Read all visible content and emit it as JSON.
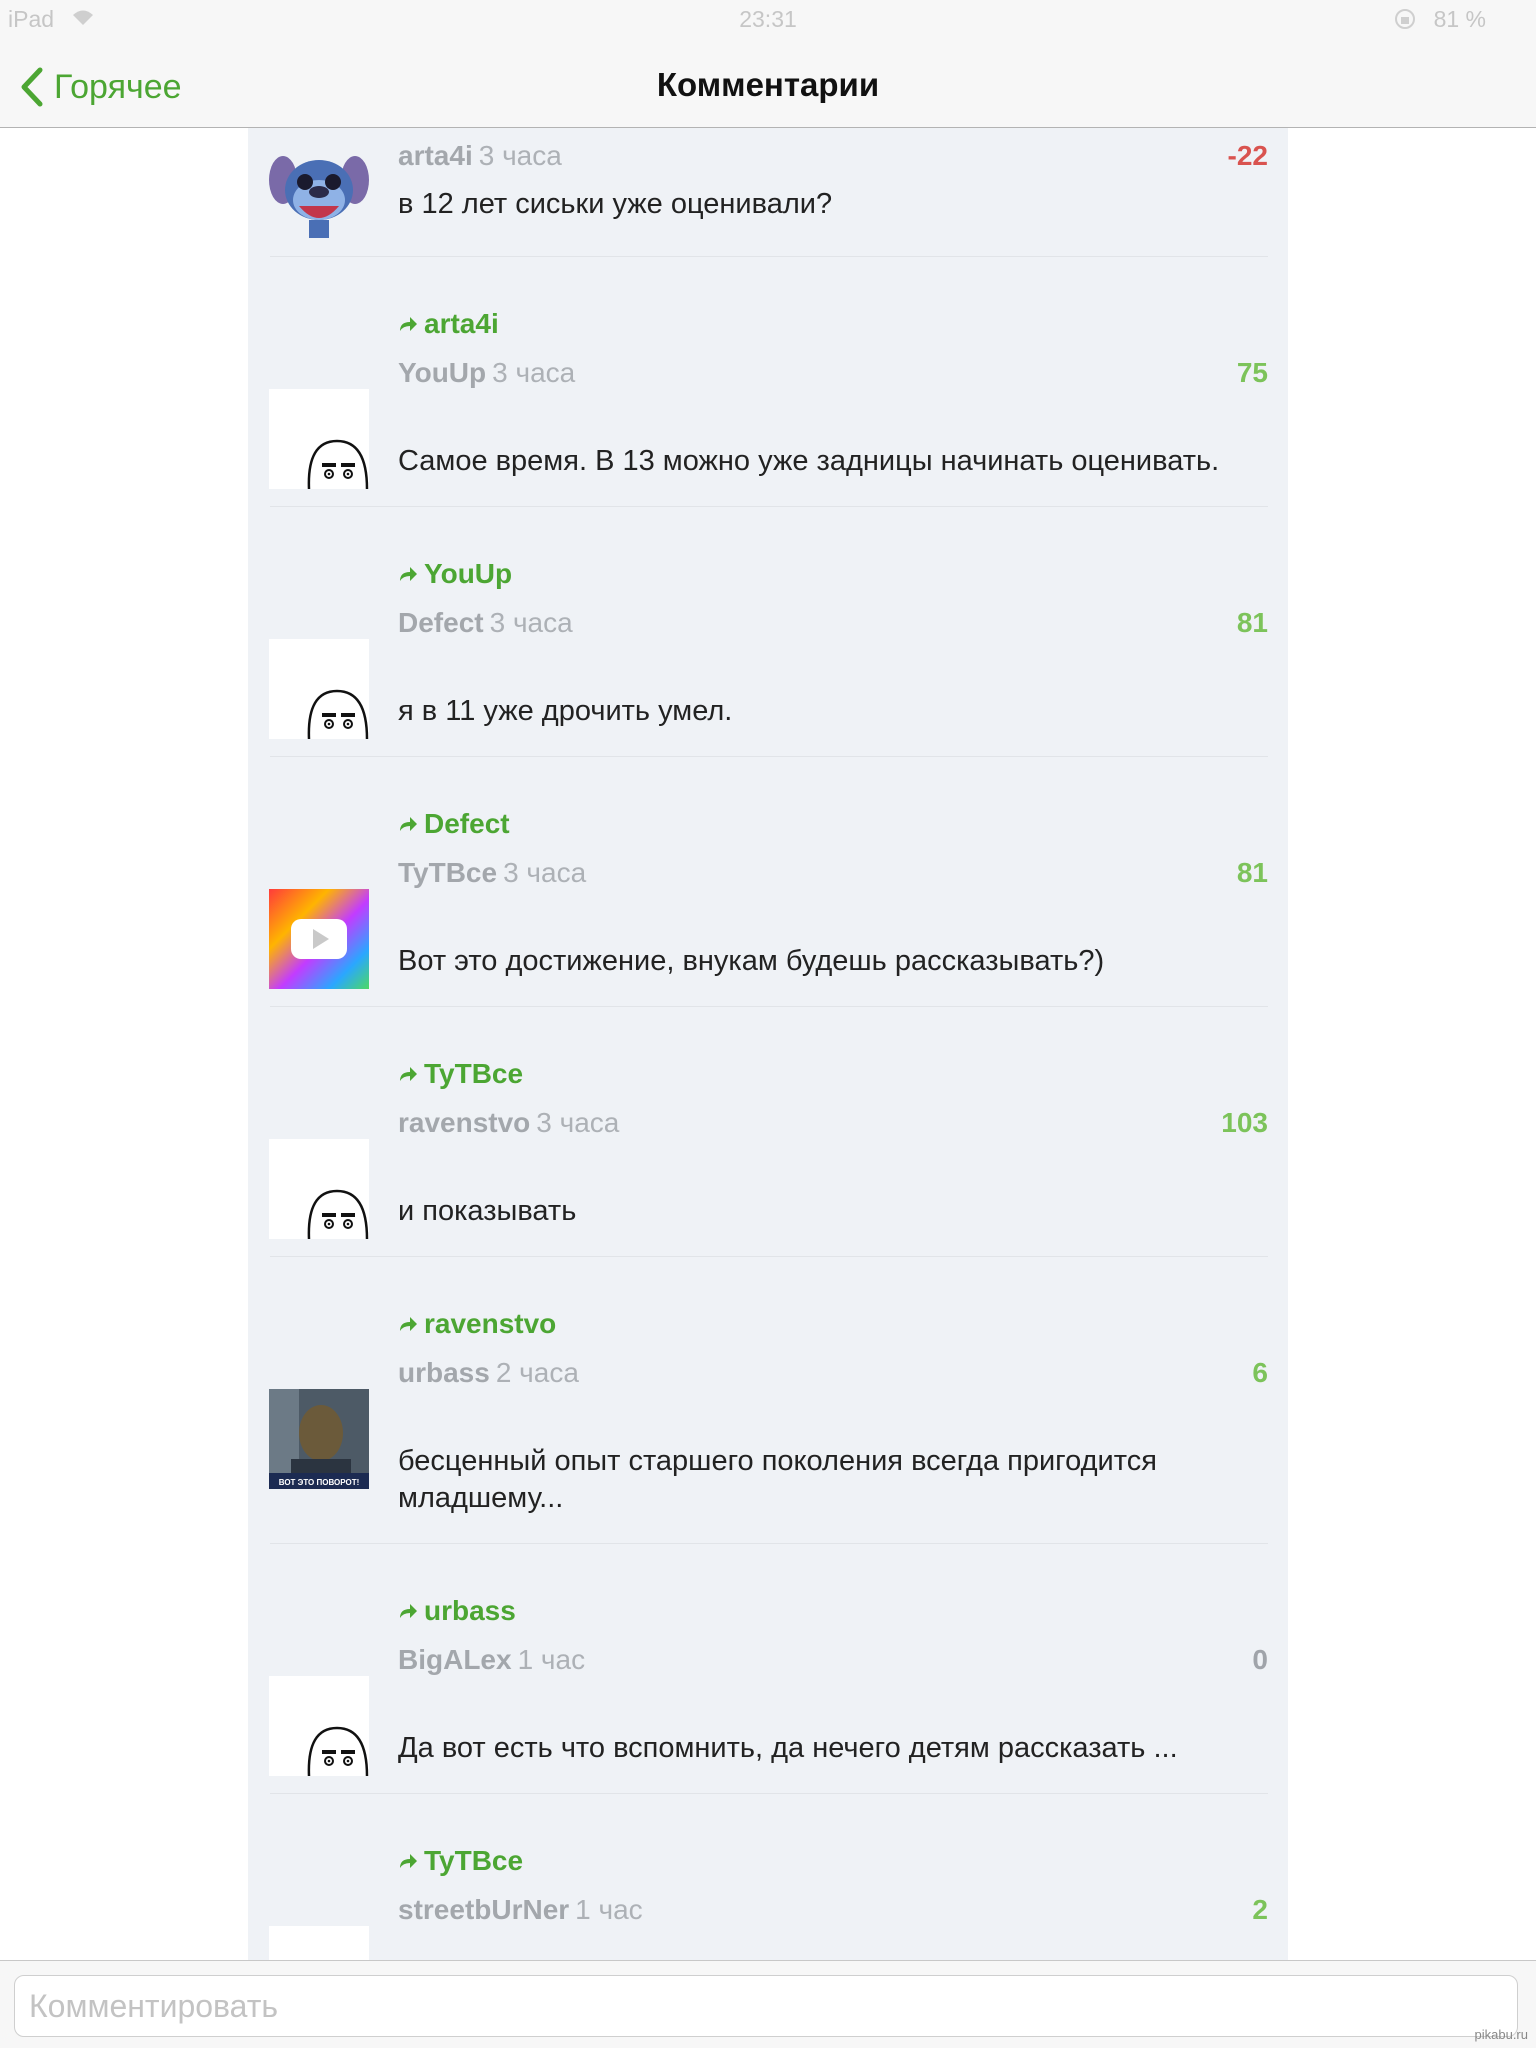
{
  "status_bar": {
    "device": "iPad",
    "time": "23:31",
    "battery": "81 %"
  },
  "nav": {
    "back_label": "Горячее",
    "title": "Комментарии"
  },
  "comments": [
    {
      "reply_to": "",
      "author": "arta4i",
      "time": "3 часа",
      "score": "-22",
      "text": "в 12 лет сиськи уже оценивали?"
    },
    {
      "reply_to": "arta4i",
      "author": "YouUp",
      "time": "3 часа",
      "score": "75",
      "text": "Самое время. В 13 можно уже задницы начинать оценивать."
    },
    {
      "reply_to": "YouUp",
      "author": "Defect",
      "time": "3 часа",
      "score": "81",
      "text": "я в 11 уже дрочить умел."
    },
    {
      "reply_to": "Defect",
      "author": "TyTBce",
      "time": "3 часа",
      "score": "81",
      "text": "Вот это достижение, внукам будешь рассказывать?)"
    },
    {
      "reply_to": "TyTBce",
      "author": "ravenstvo",
      "time": "3 часа",
      "score": "103",
      "text": "и показывать"
    },
    {
      "reply_to": "ravenstvo",
      "author": "urbass",
      "time": "2 часа",
      "score": "6",
      "text": "бесценный опыт старшего поколения всегда пригодится младшему..."
    },
    {
      "reply_to": "urbass",
      "author": "BigALex",
      "time": "1 час",
      "score": "0",
      "text": "Да вот есть что вспомнить, да нечего детям рассказать ..."
    },
    {
      "reply_to": "TyTBce",
      "author": "streetbUrNer",
      "time": "1 час",
      "score": "2",
      "text": ""
    }
  ],
  "avatar_caption": "ВОТ ЭТО ПОВОРОТ!",
  "input": {
    "placeholder": "Комментировать",
    "value": ""
  },
  "watermark": "pikabu.ru",
  "colors": {
    "accent": "#4ca633",
    "negative": "#d9534f",
    "positive": "#7cc35a",
    "neutral": "#a0a4aa"
  }
}
